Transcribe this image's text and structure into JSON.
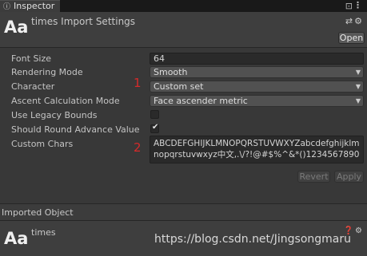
{
  "tab": {
    "icon": "info-icon",
    "label": "Inspector"
  },
  "header": {
    "icon_text": "Aa",
    "title": "times Import Settings",
    "open_button": "Open"
  },
  "fields": {
    "font_size": {
      "label": "Font Size",
      "value": "64"
    },
    "rendering_mode": {
      "label": "Rendering Mode",
      "value": "Smooth"
    },
    "character": {
      "label": "Character",
      "value": "Custom set"
    },
    "ascent_mode": {
      "label": "Ascent Calculation Mode",
      "value": "Face ascender metric"
    },
    "use_legacy_bounds": {
      "label": "Use Legacy Bounds",
      "checked": false
    },
    "round_advance": {
      "label": "Should Round Advance Value",
      "checked": true
    },
    "custom_chars": {
      "label": "Custom Chars",
      "value": "ABCDEFGHIJKLMNOPQRSTUVWXYZabcdefghijklmnopqrstuvwxyz中文,.\\/?!@#$%^&*()1234567890"
    }
  },
  "annotations": {
    "one": "1",
    "two": "2"
  },
  "buttons": {
    "revert": "Revert",
    "apply": "Apply"
  },
  "imported_object": {
    "label": "Imported Object",
    "icon_text": "Aa",
    "name": "times"
  },
  "watermark": "https://blog.csdn.net/Jingsongmaru"
}
